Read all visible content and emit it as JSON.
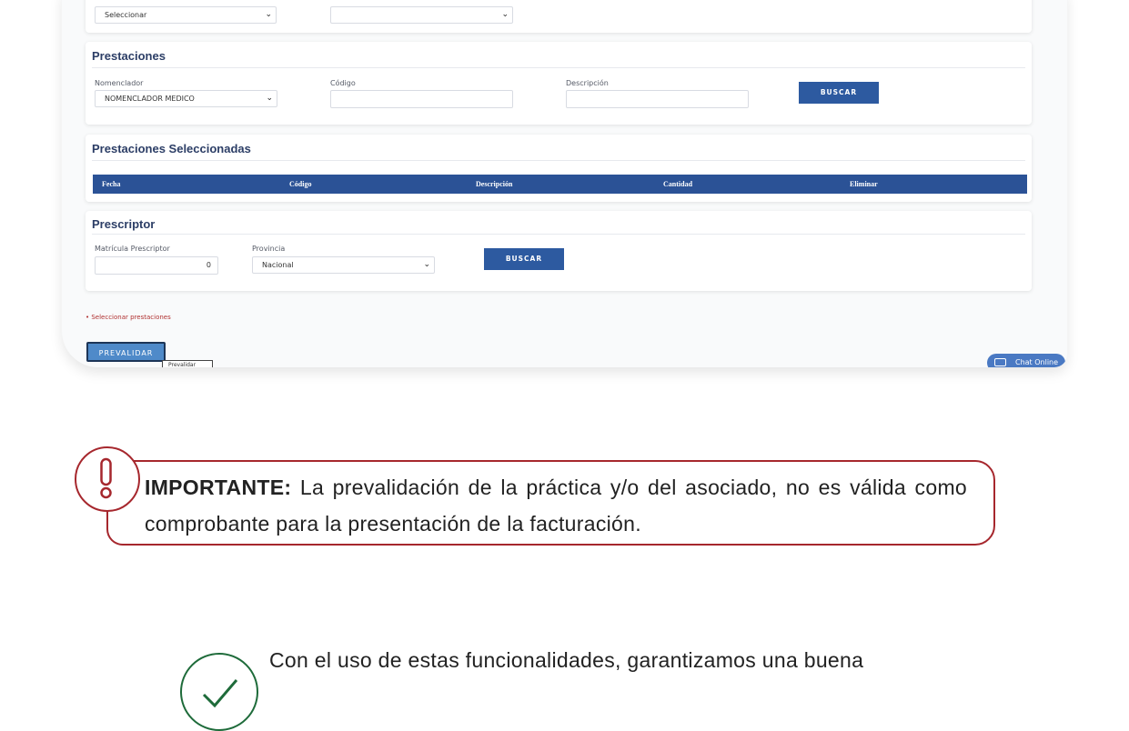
{
  "form": {
    "top_row": {
      "select_value": "Seleccionar"
    },
    "prestaciones": {
      "title": "Prestaciones",
      "nomenclador_label": "Nomenclador",
      "nomenclador_value": "NOMENCLADOR MEDICO",
      "codigo_label": "Código",
      "codigo_value": "",
      "descripcion_label": "Descripción",
      "descripcion_value": "",
      "buscar_label": "BUSCAR"
    },
    "seleccionadas": {
      "title": "Prestaciones Seleccionadas",
      "columns": [
        "Fecha",
        "Código",
        "Descripción",
        "Cantidad",
        "Eliminar"
      ]
    },
    "prescriptor": {
      "title": "Prescriptor",
      "matricula_label": "Matrícula Prescriptor",
      "matricula_value": "0",
      "provincia_label": "Provincia",
      "provincia_value": "Nacional",
      "buscar_label": "BUSCAR"
    },
    "validation_note": "Seleccionar prestaciones",
    "prevalidar_label": "PREVALIDAR",
    "tooltip_text": "Prevalidar",
    "chat_label": "Chat Online"
  },
  "callout": {
    "bold": "IMPORTANTE:",
    "text": " La prevalidación de la práctica y/o del asociado, no es válida como comprobante para la presentación de la facturación."
  },
  "bottom": {
    "text": "Con el uso de estas funcionalidades, garantizamos una buena"
  },
  "icons": {
    "alert": "exclamation-icon",
    "check": "checkmark-icon",
    "chat": "chat-icon"
  },
  "colors": {
    "primary_blue": "#2b5296",
    "alert_red": "#a6272d",
    "check_green": "#1e6b3a"
  }
}
